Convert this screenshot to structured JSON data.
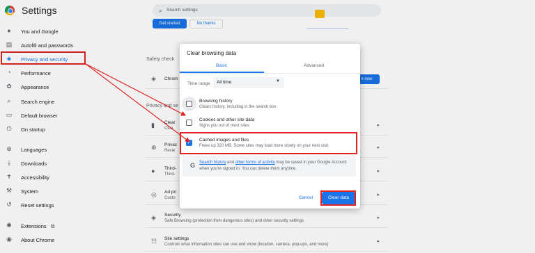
{
  "app": {
    "title": "Settings"
  },
  "search": {
    "placeholder": "Search settings"
  },
  "sidebar": {
    "items": [
      {
        "label": "You and Google",
        "icon": "person-icon"
      },
      {
        "label": "Autofill and passwords",
        "icon": "clipboard-icon"
      },
      {
        "label": "Privacy and security",
        "icon": "shield-icon"
      },
      {
        "label": "Performance",
        "icon": "speedometer-icon"
      },
      {
        "label": "Appearance",
        "icon": "palette-icon"
      },
      {
        "label": "Search engine",
        "icon": "search-icon"
      },
      {
        "label": "Default browser",
        "icon": "browser-icon"
      },
      {
        "label": "On startup",
        "icon": "power-icon"
      },
      {
        "label": "Languages",
        "icon": "globe-icon"
      },
      {
        "label": "Downloads",
        "icon": "download-icon"
      },
      {
        "label": "Accessibility",
        "icon": "accessibility-icon"
      },
      {
        "label": "System",
        "icon": "wrench-icon"
      },
      {
        "label": "Reset settings",
        "icon": "reset-icon"
      },
      {
        "label": "Extensions",
        "icon": "puzzle-icon"
      },
      {
        "label": "About Chrome",
        "icon": "chrome-icon"
      }
    ]
  },
  "background": {
    "get_started": "Get started",
    "no_thanks": "No thanks",
    "safety_check": "Safety check",
    "safety_row_title": "Chrom",
    "check_now": "k now",
    "privacy_heading": "Privacy and se",
    "rows": [
      {
        "title": "Clear",
        "sub": "Clea"
      },
      {
        "title": "Privac",
        "sub": "Revie"
      },
      {
        "title": "Third-",
        "sub": "Third-"
      },
      {
        "title": "Ad pri",
        "sub": "Custo"
      },
      {
        "title": "Security",
        "sub": "Safe Browsing (protection from dangerous sites) and other security settings"
      },
      {
        "title": "Site settings",
        "sub": "Controls what information sites can use and show (location, camera, pop-ups, and more)"
      }
    ]
  },
  "dialog": {
    "title": "Clear browsing data",
    "tabs": {
      "basic": "Basic",
      "advanced": "Advanced"
    },
    "time_range_label": "Time range",
    "time_range_value": "All time",
    "options": [
      {
        "title": "Browsing history",
        "sub": "Clears history, including in the search box",
        "checked": false
      },
      {
        "title": "Cookies and other site data",
        "sub": "Signs you out of most sites",
        "checked": false
      },
      {
        "title": "Cached images and files",
        "sub": "Frees up 320 MB. Some sites may load more slowly on your next visit.",
        "checked": true
      }
    ],
    "google_note": {
      "link1": "Search history",
      "mid": " and ",
      "link2": "other forms of activity",
      "rest": " may be saved in your Google Account when you're signed in. You can delete them anytime."
    },
    "cancel": "Cancel",
    "clear": "Clear data"
  },
  "colors": {
    "accent": "#1a73e8",
    "highlight": "#e02424"
  }
}
